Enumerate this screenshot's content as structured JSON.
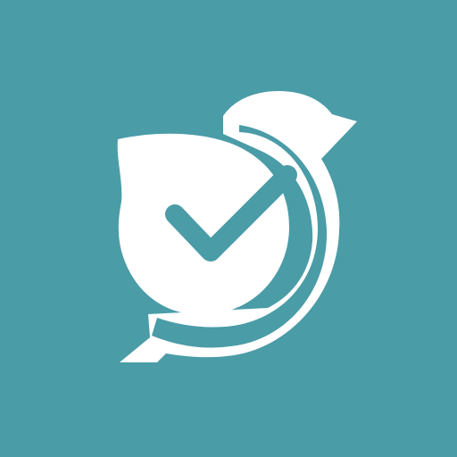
{
  "icon": {
    "name": "bird-checkmark-icon",
    "colors": {
      "background": "#4a9ca7",
      "foreground": "#ffffff"
    }
  }
}
